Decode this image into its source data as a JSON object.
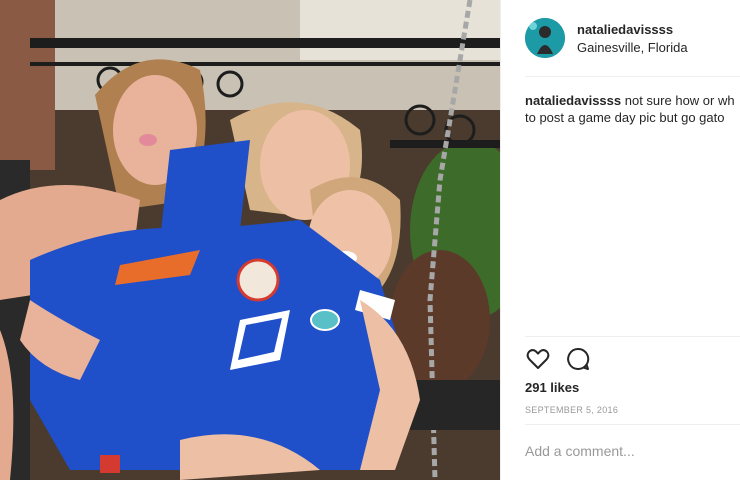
{
  "post": {
    "username": "nataliedavissss",
    "location": "Gainesville, Florida",
    "caption_text": "not sure how or wh... to post a game day pic but go gat...",
    "caption_line1": "not sure how or wh",
    "caption_line2": "to post a game day pic but go gato",
    "likes": "291 likes",
    "date": "SEPTEMBER 5, 2016",
    "comment_placeholder": "Add a comment..."
  },
  "icons": {
    "like": "heart-icon",
    "comment": "speech-bubble-icon"
  },
  "colors": {
    "text": "#262626",
    "muted": "#999999",
    "divider": "#efefef",
    "jersey_blue": "#1f4fc9"
  }
}
